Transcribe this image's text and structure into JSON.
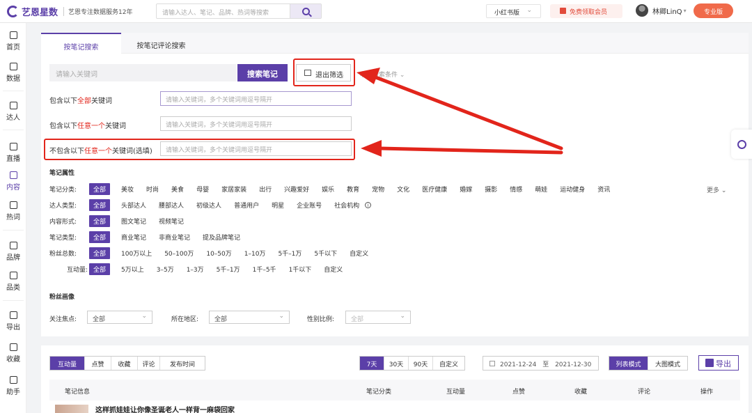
{
  "topbar": {
    "logo": "艺恩星数",
    "tagline": "艺恩专注数据服务12年",
    "search_placeholder": "请输入达人、笔记、品牌、热词等搜索",
    "platform": "小红书版",
    "free_vip": "免费领取会员",
    "username": "林卿LinQ",
    "pro_badge": "专业版"
  },
  "sidebar": {
    "items": [
      {
        "label": "首页",
        "icon": "monitor-icon"
      },
      {
        "label": "数据",
        "icon": "bar-chart-icon"
      },
      {
        "label": "达人",
        "icon": "person-icon"
      },
      {
        "label": "直播",
        "icon": "play-icon"
      },
      {
        "label": "内容",
        "icon": "document-icon"
      },
      {
        "label": "热词",
        "icon": "bar-chart-icon"
      },
      {
        "label": "品牌",
        "icon": "diamond-icon"
      },
      {
        "label": "品类",
        "icon": "box-icon"
      },
      {
        "label": "导出",
        "icon": "export-icon"
      },
      {
        "label": "收藏",
        "icon": "bookmark-icon"
      },
      {
        "label": "助手",
        "icon": "cart-icon"
      }
    ]
  },
  "search": {
    "tabs": [
      "按笔记搜索",
      "按笔记评论搜索"
    ],
    "keyword_placeholder": "请输入关键词",
    "search_button": "搜索笔记",
    "exit_filter": "退出筛选",
    "more_conditions": "收起搜索条件",
    "filters": [
      {
        "prefix": "包含以下",
        "highlight": "全部",
        "suffix": "关键词",
        "placeholder": "请输入关键词，多个关键词用逗号隔开"
      },
      {
        "prefix": "包含以下",
        "highlight": "任意一个",
        "suffix": "关键词",
        "placeholder": "请输入关键词，多个关键词用逗号隔开"
      },
      {
        "prefix": "不包含以下",
        "highlight": "任意一个",
        "suffix": "关键词(选填)",
        "placeholder": "请输入关键词，多个关键词用逗号隔开"
      }
    ]
  },
  "attributes": {
    "title": "笔记属性",
    "more": "更多",
    "rows": [
      {
        "label": "笔记分类:",
        "options": [
          "全部",
          "美妆",
          "时尚",
          "美食",
          "母婴",
          "家居家装",
          "出行",
          "兴趣爱好",
          "娱乐",
          "教育",
          "宠物",
          "文化",
          "医疗健康",
          "婚嫁",
          "摄影",
          "情感",
          "萌娃",
          "运动健身",
          "资讯"
        ]
      },
      {
        "label": "达人类型:",
        "options": [
          "全部",
          "头部达人",
          "腰部达人",
          "初级达人",
          "普通用户",
          "明星",
          "企业账号",
          "社会机构"
        ]
      },
      {
        "label": "内容形式:",
        "options": [
          "全部",
          "图文笔记",
          "视频笔记"
        ]
      },
      {
        "label": "笔记类型:",
        "options": [
          "全部",
          "商业笔记",
          "非商业笔记",
          "提及品牌笔记"
        ]
      },
      {
        "label": "粉丝总数:",
        "options": [
          "全部",
          "100万以上",
          "50–100万",
          "10–50万",
          "1–10万",
          "5千–1万",
          "5千以下",
          "自定义"
        ]
      },
      {
        "label": "互动量:",
        "options": [
          "全部",
          "5万以上",
          "3–5万",
          "1–3万",
          "5千–1万",
          "1千–5千",
          "1千以下",
          "自定义"
        ]
      }
    ]
  },
  "fans": {
    "title": "粉丝画像",
    "focus_label": "关注焦点:",
    "focus_value": "全部",
    "region_label": "所在地区:",
    "region_value": "全部",
    "gender_label": "性别比例:",
    "gender_value": "全部"
  },
  "list": {
    "sort_tabs": [
      "互动量",
      "点赞",
      "收藏",
      "评论",
      "发布时间"
    ],
    "range_tabs": [
      "7天",
      "30天",
      "90天",
      "自定义"
    ],
    "date_start": "2021-12-24",
    "date_sep": "至",
    "date_end": "2021-12-30",
    "view_tabs": [
      "列表模式",
      "大图模式"
    ],
    "export": "导出",
    "columns": [
      "笔记信息",
      "笔记分类",
      "互动量",
      "点赞",
      "收藏",
      "评论",
      "操作"
    ],
    "first_row_title": "这样抓娃娃让你像圣诞老人一样背一麻袋回家"
  },
  "colors": {
    "accent": "#5b3fa8",
    "highlight_red": "#e2251b",
    "pro": "#f06a4a"
  }
}
